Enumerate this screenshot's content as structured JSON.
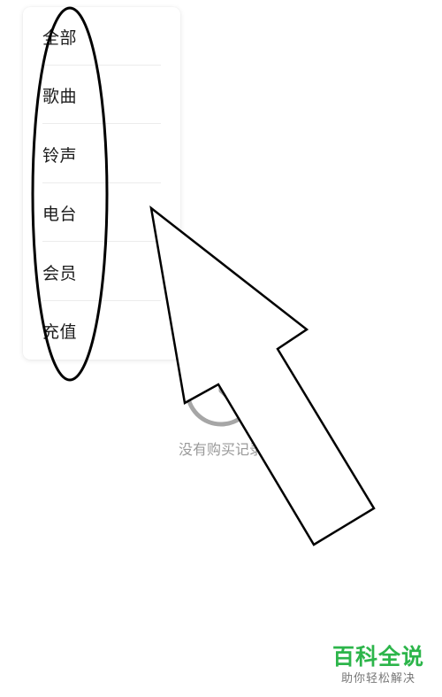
{
  "menu": {
    "items": [
      {
        "label": "全部"
      },
      {
        "label": "歌曲"
      },
      {
        "label": "铃声"
      },
      {
        "label": "电台"
      },
      {
        "label": "会员"
      },
      {
        "label": "充值"
      }
    ]
  },
  "empty_state": {
    "icon": "clock-icon",
    "message": "没有购买记录"
  },
  "watermark": {
    "title": "百科全说",
    "subtitle": "助你轻松解决",
    "color": "#2cb54a"
  },
  "annotation": {
    "ellipse_icon": "highlight-ellipse",
    "arrow_icon": "pointer-arrow"
  }
}
